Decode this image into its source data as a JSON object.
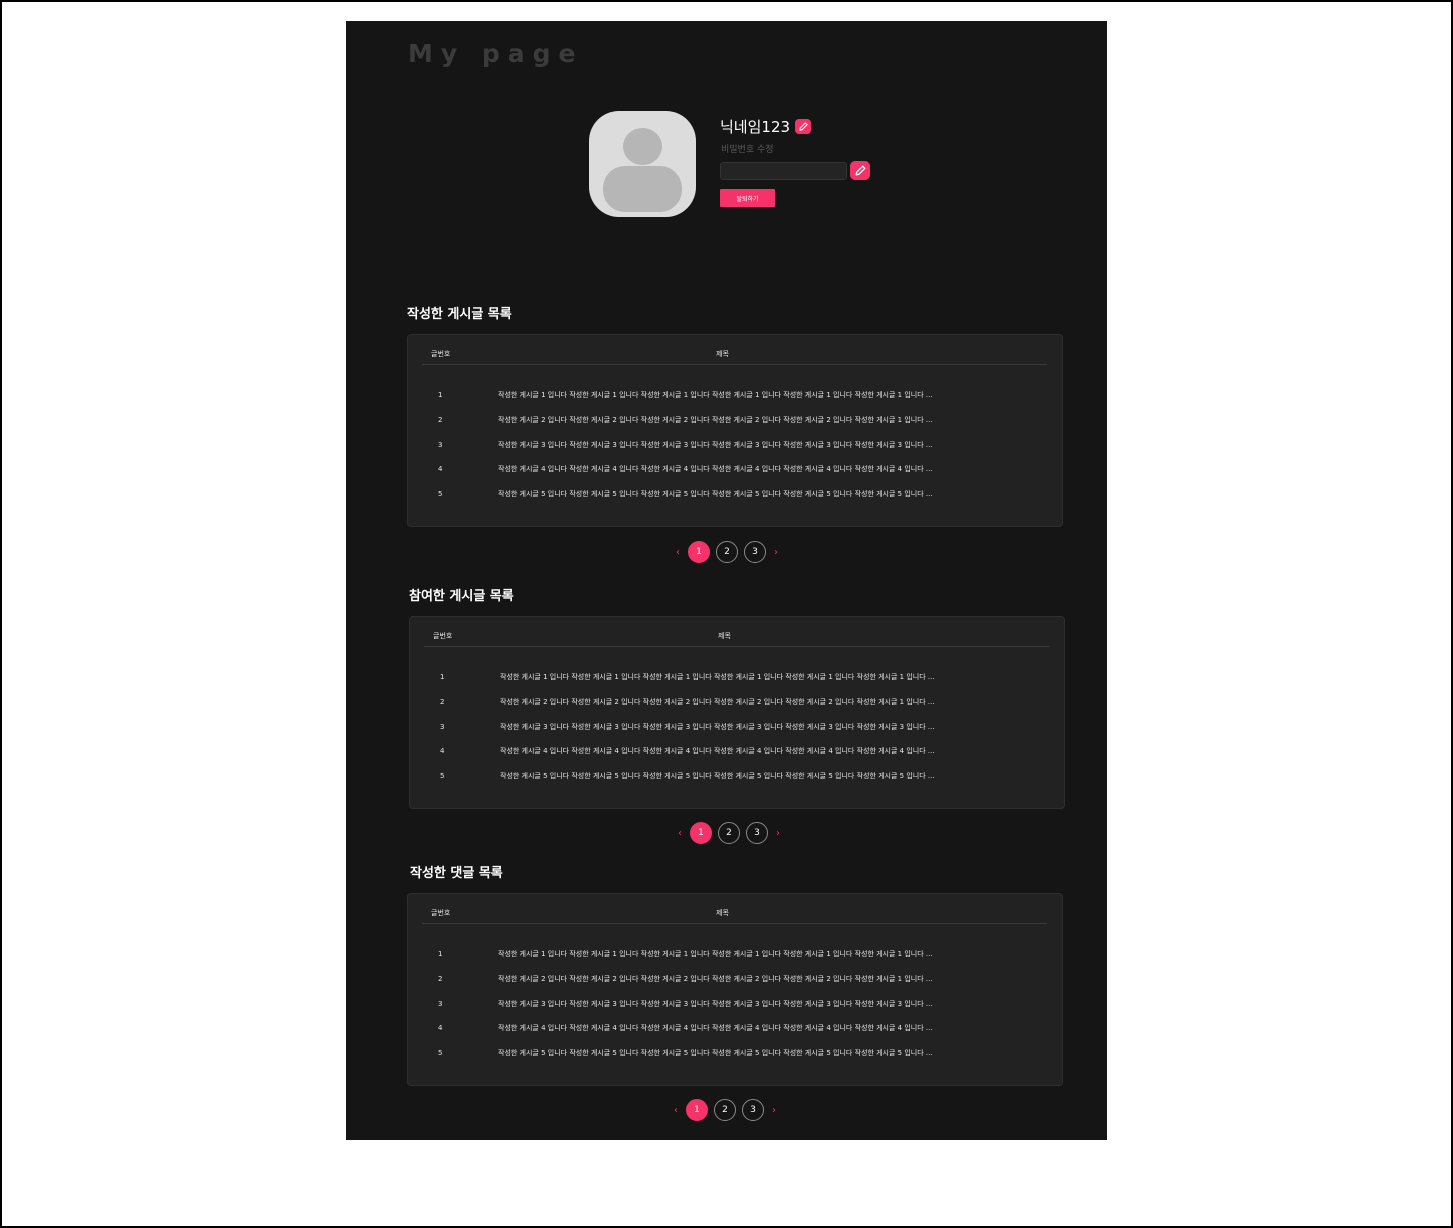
{
  "page": {
    "title": "My page"
  },
  "profile": {
    "nickname": "닉네임123",
    "password_label": "비밀번호 수정",
    "password_value": "",
    "withdraw_label": "탈퇴하기"
  },
  "table_headers": {
    "number": "글번호",
    "title": "제목"
  },
  "sections": [
    {
      "title": "작성한 게시글 목록",
      "rows": [
        {
          "no": "1",
          "title": "작성한 게시글 1 입니다 작성한 게시글 1 입니다 작성한 게시글 1 입니다 작성한 게시글 1 입니다 작성한 게시글 1 입니다 작성한 게시글 1 입니다 ..."
        },
        {
          "no": "2",
          "title": "작성한 게시글 2 입니다 작성한 게시글 2 입니다 작성한 게시글 2 입니다 작성한 게시글 2 입니다 작성한 게시글 2 입니다 작성한 게시글 1 입니다 ..."
        },
        {
          "no": "3",
          "title": "작성한 게시글 3 입니다 작성한 게시글 3 입니다 작성한 게시글 3 입니다 작성한 게시글 3 입니다 작성한 게시글 3 입니다 작성한 게시글 3 입니다 ..."
        },
        {
          "no": "4",
          "title": "작성한 게시글 4 입니다 작성한 게시글 4 입니다 작성한 게시글 4 입니다 작성한 게시글 4 입니다 작성한 게시글 4 입니다 작성한 게시글 4 입니다 ..."
        },
        {
          "no": "5",
          "title": "작성한 게시글 5 입니다 작성한 게시글 5 입니다 작성한 게시글 5 입니다 작성한 게시글 5 입니다 작성한 게시글 5 입니다 작성한 게시글 5 입니다 ..."
        }
      ],
      "pager": {
        "prev": "‹",
        "pages": [
          "1",
          "2",
          "3"
        ],
        "active": "1",
        "next": "›"
      }
    },
    {
      "title": "참여한 게시글 목록",
      "rows": [
        {
          "no": "1",
          "title": "작성한 게시글 1 입니다 작성한 게시글 1 입니다 작성한 게시글 1 입니다 작성한 게시글 1 입니다 작성한 게시글 1 입니다 작성한 게시글 1 입니다 ..."
        },
        {
          "no": "2",
          "title": "작성한 게시글 2 입니다 작성한 게시글 2 입니다 작성한 게시글 2 입니다 작성한 게시글 2 입니다 작성한 게시글 2 입니다 작성한 게시글 1 입니다 ..."
        },
        {
          "no": "3",
          "title": "작성한 게시글 3 입니다 작성한 게시글 3 입니다 작성한 게시글 3 입니다 작성한 게시글 3 입니다 작성한 게시글 3 입니다 작성한 게시글 3 입니다 ..."
        },
        {
          "no": "4",
          "title": "작성한 게시글 4 입니다 작성한 게시글 4 입니다 작성한 게시글 4 입니다 작성한 게시글 4 입니다 작성한 게시글 4 입니다 작성한 게시글 4 입니다 ..."
        },
        {
          "no": "5",
          "title": "작성한 게시글 5 입니다 작성한 게시글 5 입니다 작성한 게시글 5 입니다 작성한 게시글 5 입니다 작성한 게시글 5 입니다 작성한 게시글 5 입니다 ..."
        }
      ],
      "pager": {
        "prev": "‹",
        "pages": [
          "1",
          "2",
          "3"
        ],
        "active": "1",
        "next": "›"
      }
    },
    {
      "title": "작성한 댓글 목록",
      "rows": [
        {
          "no": "1",
          "title": "작성한 게시글 1 입니다 작성한 게시글 1 입니다 작성한 게시글 1 입니다 작성한 게시글 1 입니다 작성한 게시글 1 입니다 작성한 게시글 1 입니다 ..."
        },
        {
          "no": "2",
          "title": "작성한 게시글 2 입니다 작성한 게시글 2 입니다 작성한 게시글 2 입니다 작성한 게시글 2 입니다 작성한 게시글 2 입니다 작성한 게시글 1 입니다 ..."
        },
        {
          "no": "3",
          "title": "작성한 게시글 3 입니다 작성한 게시글 3 입니다 작성한 게시글 3 입니다 작성한 게시글 3 입니다 작성한 게시글 3 입니다 작성한 게시글 3 입니다 ..."
        },
        {
          "no": "4",
          "title": "작성한 게시글 4 입니다 작성한 게시글 4 입니다 작성한 게시글 4 입니다 작성한 게시글 4 입니다 작성한 게시글 4 입니다 작성한 게시글 4 입니다 ..."
        },
        {
          "no": "5",
          "title": "작성한 게시글 5 입니다 작성한 게시글 5 입니다 작성한 게시글 5 입니다 작성한 게시글 5 입니다 작성한 게시글 5 입니다 작성한 게시글 5 입니다 ..."
        }
      ],
      "pager": {
        "prev": "‹",
        "pages": [
          "1",
          "2",
          "3"
        ],
        "active": "1",
        "next": "›"
      }
    }
  ],
  "icons": {
    "edit": "pencil-icon",
    "avatar": "user-avatar-icon"
  },
  "colors": {
    "accent": "#f5336b",
    "background": "#151515",
    "panel": "#222222"
  }
}
